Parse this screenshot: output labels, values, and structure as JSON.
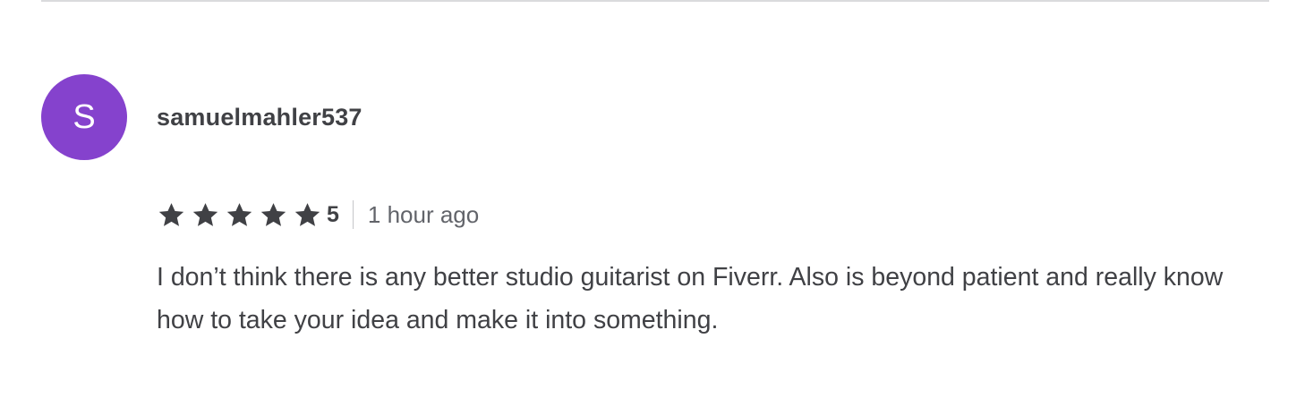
{
  "review": {
    "avatar_initial": "S",
    "avatar_color": "#8542cd",
    "username": "samuelmahler537",
    "rating": "5",
    "star_count": 5,
    "star_color": "#404145",
    "time_ago": "1 hour ago",
    "text": "I don’t think there is any better studio guitarist on Fiverr. Also is beyond patient and really know how to take your idea and make it into something."
  }
}
